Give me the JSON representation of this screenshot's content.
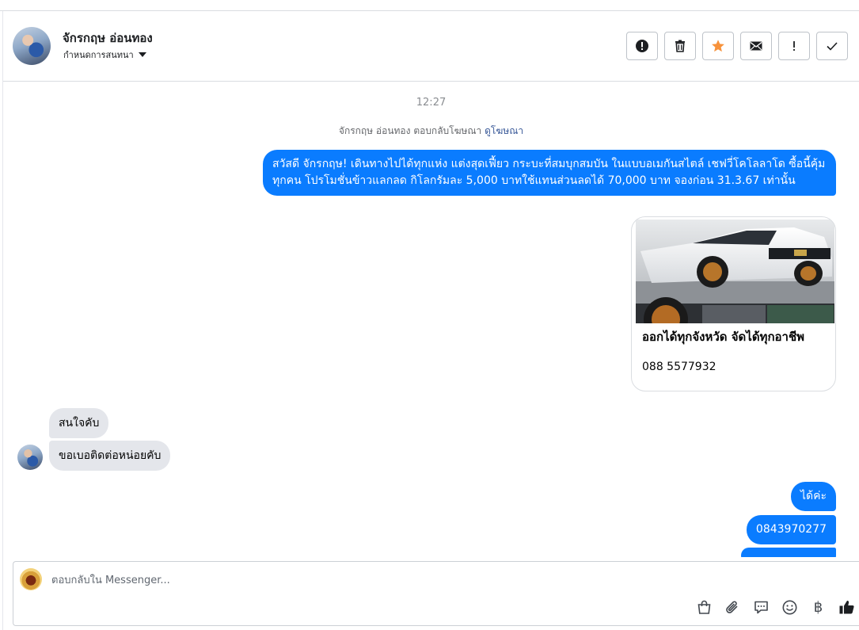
{
  "header": {
    "contact_name": "จักรกฤษ อ่อนทอง",
    "subtitle": "กำหนดการสนทนา",
    "actions": [
      {
        "name": "report-icon"
      },
      {
        "name": "trash-icon"
      },
      {
        "name": "star-icon"
      },
      {
        "name": "mail-icon"
      },
      {
        "name": "exclaim-icon"
      },
      {
        "name": "check-icon"
      }
    ]
  },
  "conversation": {
    "time": "12:27",
    "system_note": "จักรกฤษ อ่อนทอง ตอบกลับโฆษณา",
    "system_link": "ดูโฆษณา",
    "outgoing_ad_text": "สวัสดี จักรกฤษ! เดินทางไปได้ทุกแห่ง แต่งสุดเฟี้ยว กระบะที่สมบุกสมบัน ในแบบอเมกันสไตล์ เชฟวี่โคโลลาโด ซื้อนี้คุ้มทุกคน โปรโมชั่นข้าวแลกลด กิโลกรัมละ 5,000 บาทใช้แทนส่วนลดได้ 70,000 บาท จองก่อน 31.3.67 เท่านั้น",
    "card": {
      "title": "ออกได้ทุกจังหวัด จัดได้ทุกอาชีพ",
      "phone": "088 5577932"
    },
    "incoming": [
      "สนใจคับ",
      "ขอเบอติดต่อหน่อยคับ"
    ],
    "outgoing_replies": [
      "ได้ค่ะ",
      "0843970277"
    ]
  },
  "composer": {
    "placeholder": "ตอบกลับใน Messenger...",
    "currency_symbol": "฿"
  },
  "colors": {
    "accent": "#0a7cff",
    "star": "#f7923b"
  }
}
